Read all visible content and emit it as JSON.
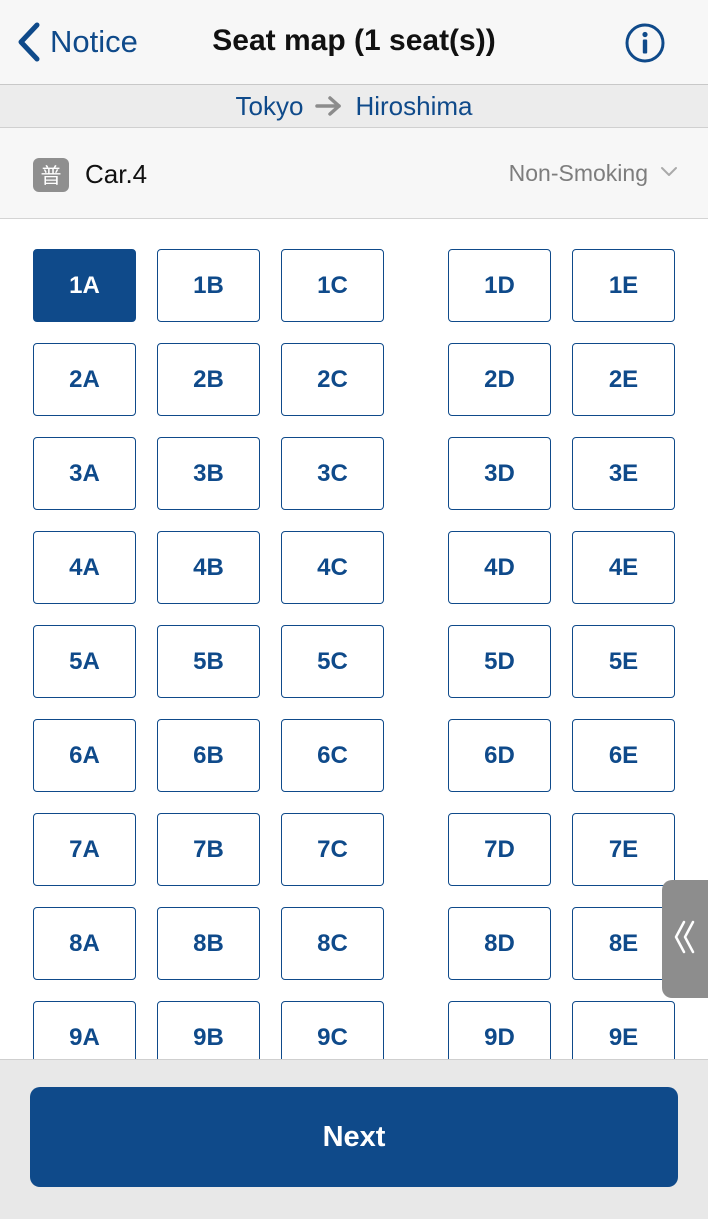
{
  "nav": {
    "back_label": "Notice",
    "title": "Seat map (1 seat(s))",
    "info_icon": "info-icon"
  },
  "route": {
    "from": "Tokyo",
    "to": "Hiroshima",
    "arrow_icon": "arrow-right-icon"
  },
  "car": {
    "badge": "普",
    "name": "Car.4",
    "smoking": "Non-Smoking"
  },
  "seats": {
    "rows": [
      "1",
      "2",
      "3",
      "4",
      "5",
      "6",
      "7",
      "8",
      "9"
    ],
    "columns": [
      "A",
      "B",
      "C",
      "D",
      "E"
    ],
    "selected": "1A"
  },
  "side_tab": {
    "label": "《"
  },
  "footer": {
    "next_label": "Next"
  },
  "colors": {
    "accent": "#0f4a8a",
    "badge": "#8f8f8f",
    "side_tab": "#8d8d8d"
  }
}
